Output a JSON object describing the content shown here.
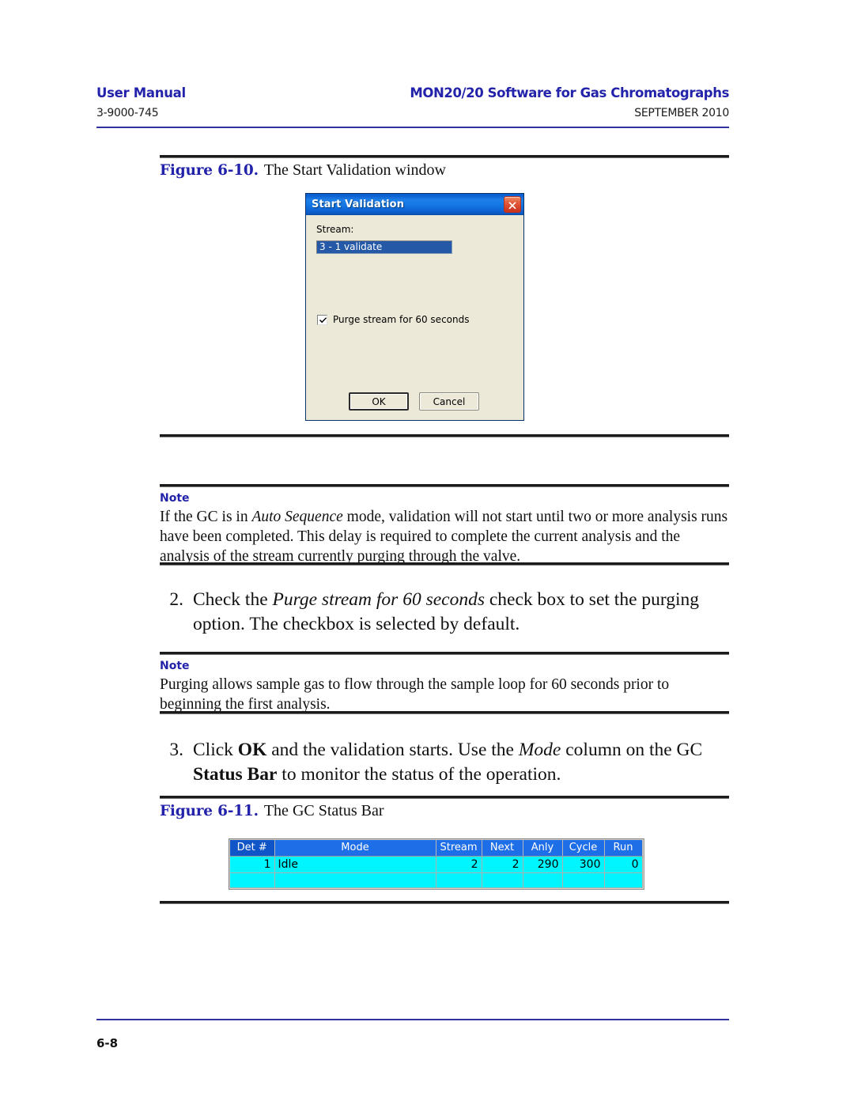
{
  "header": {
    "left_title": "User Manual",
    "right_title": "MON20/20 Software for Gas Chromatographs",
    "doc_number": "3-9000-745",
    "date": "SEPTEMBER 2010"
  },
  "figure_610": {
    "number": "Figure 6-10.",
    "caption": "The Start Validation window"
  },
  "dialog": {
    "title": "Start Validation",
    "close_icon": "close-icon",
    "stream_label": "Stream:",
    "stream_value": "3 - 1 validate",
    "checkbox_label": "Purge stream for 60 seconds",
    "checkbox_checked": true,
    "ok_label": "OK",
    "cancel_label": "Cancel",
    "accent_titlebar": "#1477e4",
    "accent_close": "#c8301a",
    "face_color": "#ece9d8",
    "selection_color": "#2559a8"
  },
  "note1": {
    "title": "Note",
    "text_part1": "If the GC is in ",
    "text_italic": "Auto Sequence",
    "text_part2": " mode, validation will not start until two or more analysis runs have been completed. This delay is required to complete the current analysis and the analysis of the stream currently purging through the valve."
  },
  "step2": {
    "number": "2.",
    "text_part1": "Check the ",
    "text_italic": "Purge stream for 60 seconds",
    "text_part2": " check box to set the purging option. The checkbox is selected by default."
  },
  "note2": {
    "title": "Note",
    "text": "Purging allows sample gas to flow through the sample loop for 60 seconds prior to beginning the first analysis."
  },
  "step3": {
    "number": "3.",
    "text_part1": "Click ",
    "text_bold1": "OK",
    "text_part2": " and the validation starts.  Use the ",
    "text_italic": "Mode",
    "text_part3": " column on the GC ",
    "text_bold2": "Status Bar",
    "text_part4": " to monitor the status of the operation."
  },
  "figure_611": {
    "number": "Figure 6-11.",
    "caption": "The GC Status Bar"
  },
  "status_bar": {
    "columns": [
      "Det #",
      "Mode",
      "Stream",
      "Next",
      "Anly",
      "Cycle",
      "Run"
    ],
    "rows": [
      {
        "det": "1",
        "mode": "Idle",
        "stream": "2",
        "next": "2",
        "anly": "290",
        "cycle": "300",
        "run": "0"
      }
    ],
    "header_color": "#1e6ee8",
    "cell_color": "#00f5ff"
  },
  "footer": {
    "page_number": "6-8"
  }
}
